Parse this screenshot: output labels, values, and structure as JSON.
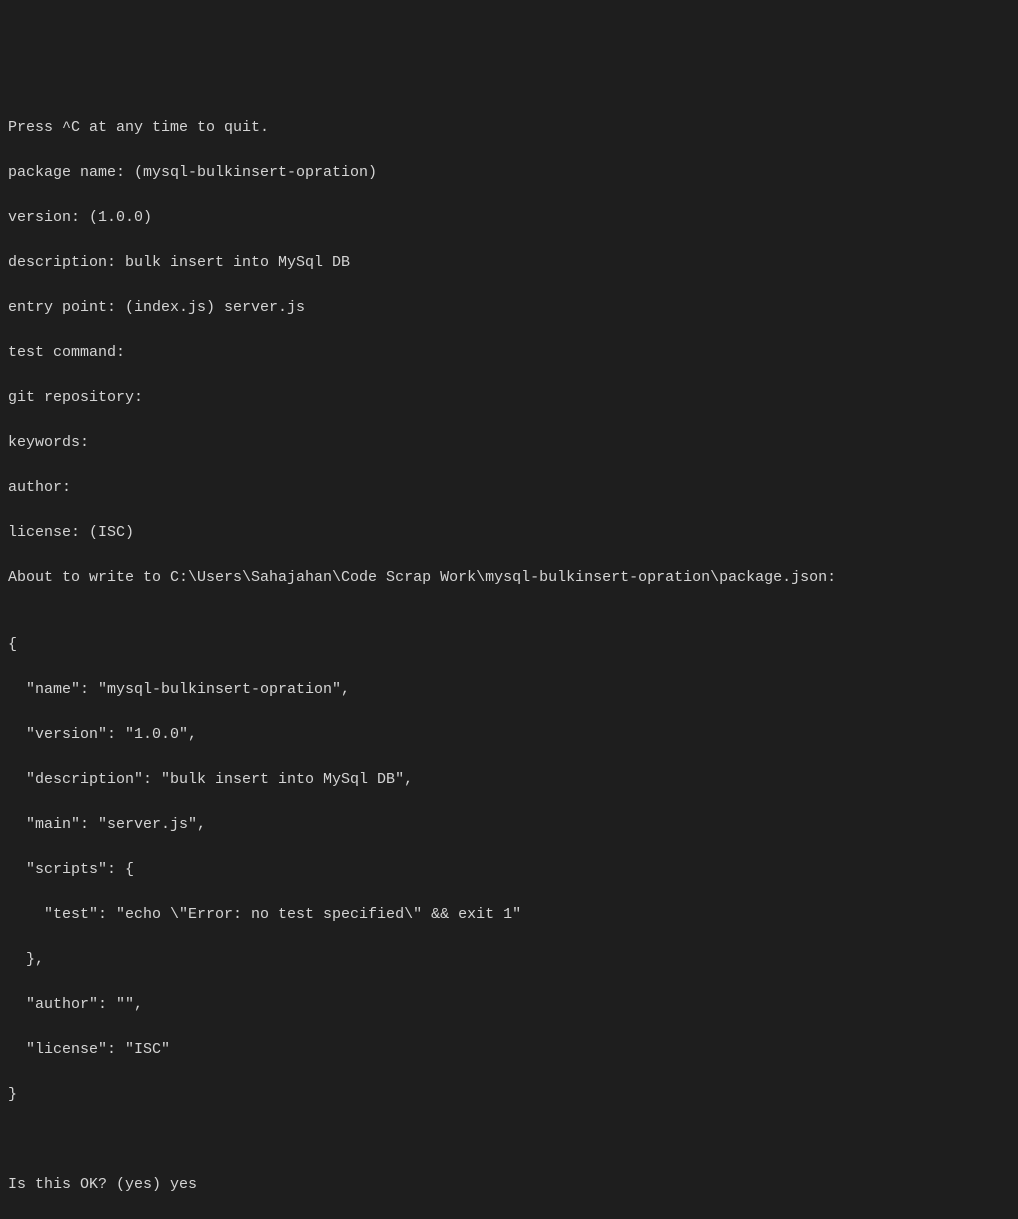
{
  "terminal": {
    "lines": [
      "Press ^C at any time to quit.",
      "package name: (mysql-bulkinsert-opration)",
      "version: (1.0.0)",
      "description: bulk insert into MySql DB",
      "entry point: (index.js) server.js",
      "test command:",
      "git repository:",
      "keywords:",
      "author:",
      "license: (ISC)",
      "About to write to C:\\Users\\Sahajahan\\Code Scrap Work\\mysql-bulkinsert-opration\\package.json:",
      "",
      "{",
      "  \"name\": \"mysql-bulkinsert-opration\",",
      "  \"version\": \"1.0.0\",",
      "  \"description\": \"bulk insert into MySql DB\",",
      "  \"main\": \"server.js\",",
      "  \"scripts\": {",
      "    \"test\": \"echo \\\"Error: no test specified\\\" && exit 1\"",
      "  },",
      "  \"author\": \"\",",
      "  \"license\": \"ISC\"",
      "}",
      "",
      "",
      "Is this OK? (yes) yes"
    ]
  }
}
